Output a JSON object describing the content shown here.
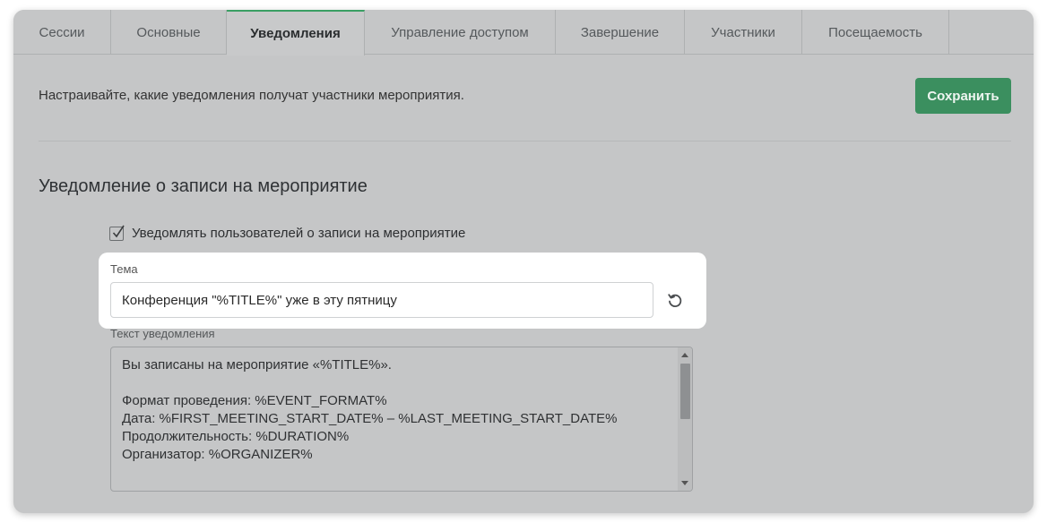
{
  "tabs": [
    {
      "label": "Сессии",
      "active": false
    },
    {
      "label": "Основные",
      "active": false
    },
    {
      "label": "Уведомления",
      "active": true
    },
    {
      "label": "Управление доступом",
      "active": false
    },
    {
      "label": "Завершение",
      "active": false
    },
    {
      "label": "Участники",
      "active": false
    },
    {
      "label": "Посещаемость",
      "active": false
    }
  ],
  "header": {
    "description": "Настраивайте, какие уведомления получат участники мероприятия.",
    "save_label": "Сохранить"
  },
  "section": {
    "title": "Уведомление о записи на мероприятие",
    "checkbox_label": "Уведомлять пользователей о записи на мероприятие",
    "checkbox_checked": true,
    "subject_label": "Тема",
    "subject_value": "Конференция \"%TITLE%\" уже в эту пятницу",
    "body_label": "Текст уведомления",
    "body_lines": [
      "Вы записаны на мероприятие «%TITLE%».",
      "",
      "Формат проведения: %EVENT_FORMAT%",
      "Дата: %FIRST_MEETING_START_DATE% – %LAST_MEETING_START_DATE%",
      "Продолжительность: %DURATION%",
      "Организатор: %ORGANIZER%"
    ]
  },
  "icons": {
    "reset": "reset-icon",
    "check": "check-icon"
  },
  "colors": {
    "accent": "#3b8f5f",
    "tab_active_border": "#3a9f64",
    "card_bg": "#c5c6c7"
  }
}
